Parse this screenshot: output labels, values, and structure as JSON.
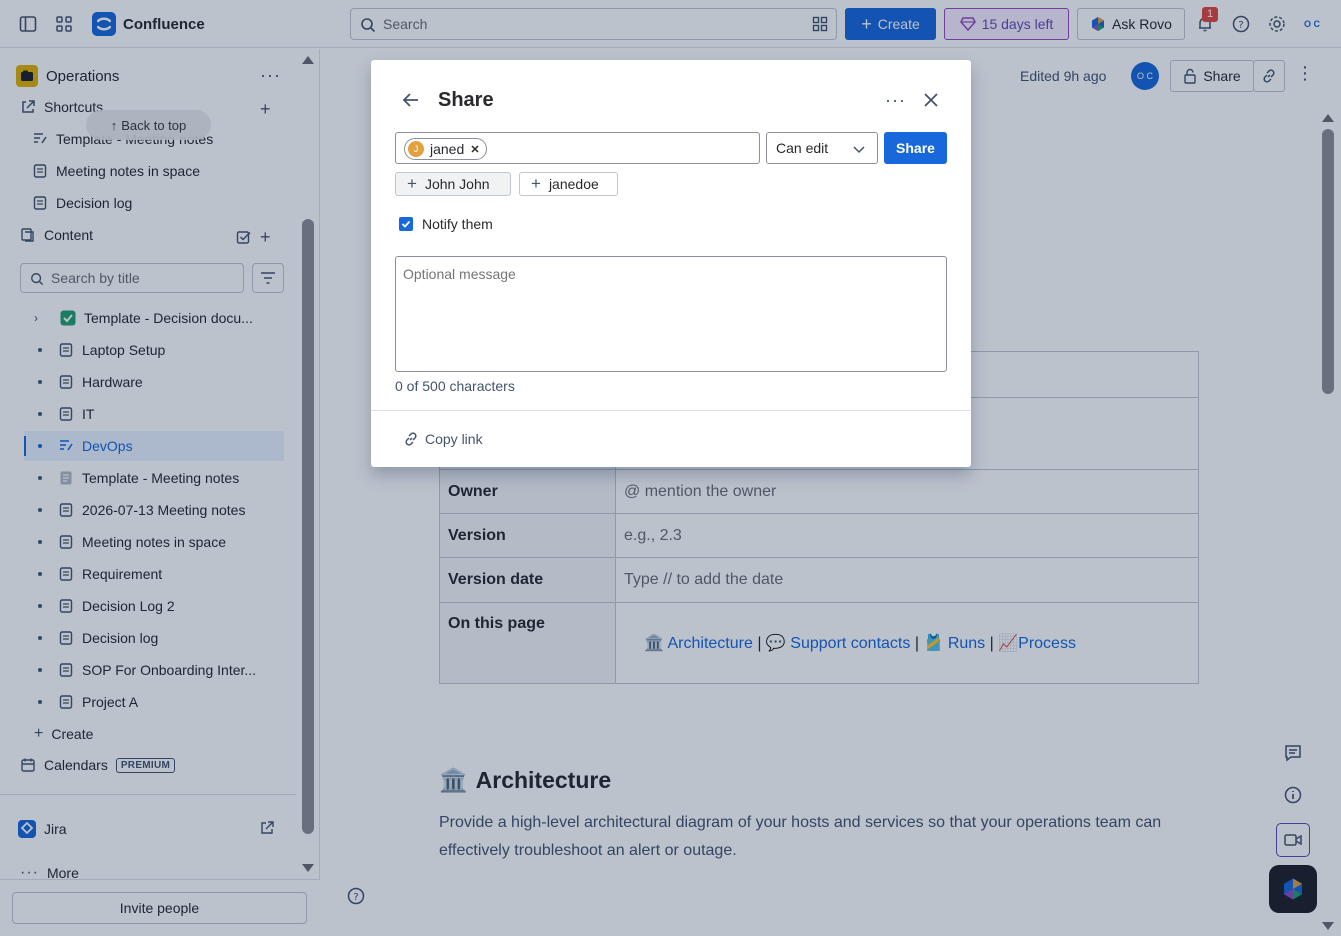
{
  "app": {
    "name": "Confluence"
  },
  "topbar": {
    "search_placeholder": "Search",
    "create_label": "Create",
    "trial_label": "15 days left",
    "rovo_label": "Ask Rovo",
    "notification_count": "1",
    "profile_initials": "O C"
  },
  "sidebar": {
    "space_name": "Operations",
    "shortcuts_label": "Shortcuts",
    "back_to_top": "Back to top",
    "shortcut_items": [
      "Template - Meeting notes",
      "Meeting notes in space",
      "Decision log"
    ],
    "content_label": "Content",
    "search_placeholder": "Search by title",
    "tree": [
      {
        "label": "Template - Decision docu...",
        "icon": "check-emoji"
      },
      {
        "label": "Laptop Setup",
        "icon": "page"
      },
      {
        "label": "Hardware",
        "icon": "page"
      },
      {
        "label": "IT",
        "icon": "page"
      },
      {
        "label": "DevOps",
        "icon": "live-page",
        "active": true
      },
      {
        "label": "Template - Meeting notes",
        "icon": "notepad"
      },
      {
        "label": "2026-07-13 Meeting notes",
        "icon": "page"
      },
      {
        "label": "Meeting notes in space",
        "icon": "page"
      },
      {
        "label": "Requirement",
        "icon": "page"
      },
      {
        "label": "Decision Log 2",
        "icon": "page"
      },
      {
        "label": "Decision log",
        "icon": "page"
      },
      {
        "label": "SOP For Onboarding Inter...",
        "icon": "page"
      },
      {
        "label": "Project A",
        "icon": "page"
      }
    ],
    "create_label": "Create",
    "calendars_label": "Calendars",
    "premium_badge": "PREMIUM",
    "jira_label": "Jira",
    "more_label": "More",
    "invite_label": "Invite people"
  },
  "page": {
    "edited": "Edited 9h ago",
    "avatar_initials": "O C",
    "share_label": "Share",
    "properties": [
      {
        "key": "Owner",
        "value": "@ mention the owner"
      },
      {
        "key": "Version",
        "value": "e.g., 2.3"
      },
      {
        "key": "Version date",
        "value": "Type // to add the date"
      },
      {
        "key": "On this page",
        "value": ""
      }
    ],
    "toc": [
      {
        "emoji": "🏛️",
        "label": "Architecture"
      },
      {
        "emoji": "💬",
        "label": "Support contacts"
      },
      {
        "emoji": "🎽",
        "label": "Runs"
      },
      {
        "emoji": "📈",
        "label": "Process"
      }
    ],
    "section_heading": "Architecture",
    "section_text": "Provide a high-level architectural diagram of your hosts and services so that your operations team can effectively troubleshoot an alert or outage."
  },
  "share_dialog": {
    "title": "Share",
    "chip_name": "janed",
    "chip_initial": "J",
    "permission": "Can edit",
    "share_button": "Share",
    "suggestions": [
      "John John",
      "janedoe"
    ],
    "notify_label": "Notify them",
    "notify_checked": true,
    "message_placeholder": "Optional message",
    "char_count": "0 of 500 characters",
    "copy_link": "Copy link"
  },
  "colors": {
    "accent": "#1868db",
    "trial_border": "#964ac0",
    "overlay": "rgba(9,30,66,0.27)"
  }
}
